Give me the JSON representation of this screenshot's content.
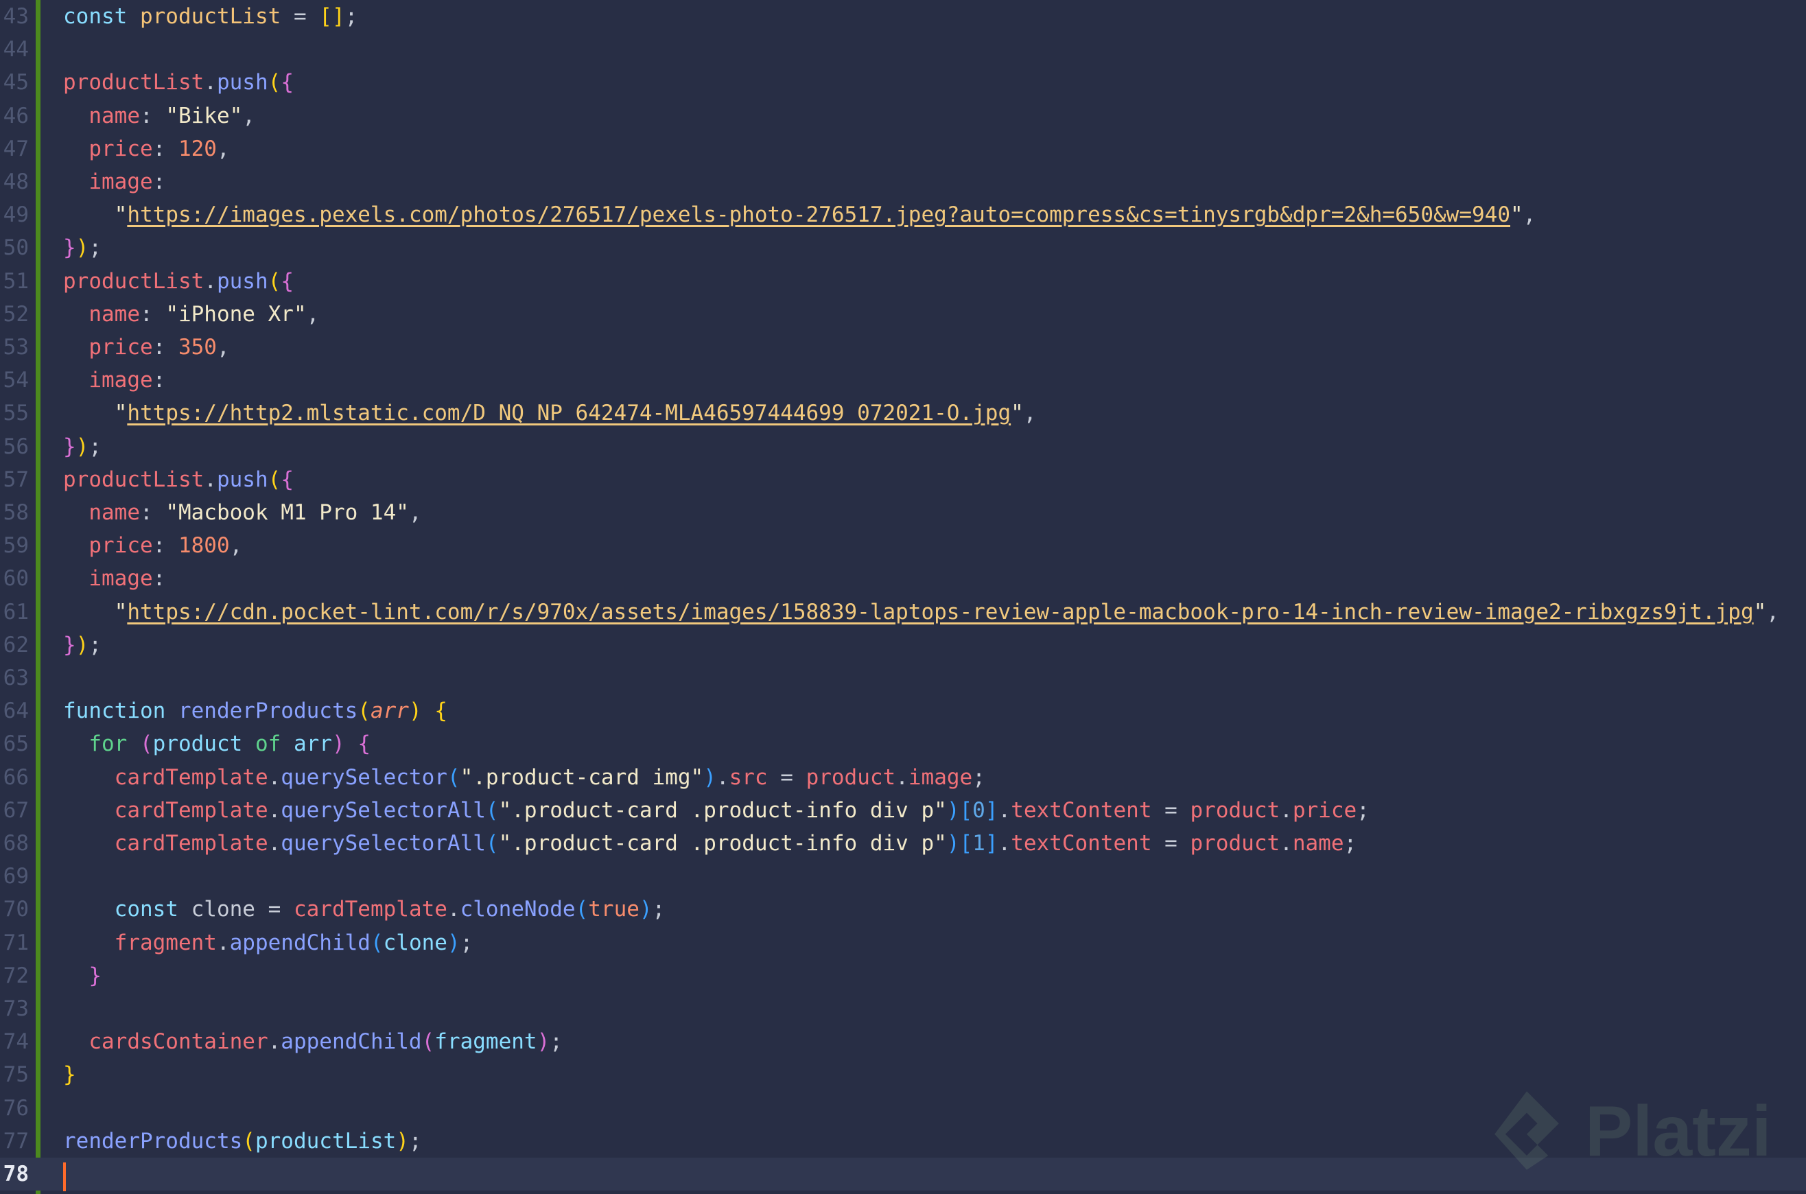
{
  "editor": {
    "active_line": 78,
    "watermark": "Platzi",
    "lines": [
      {
        "n": 43,
        "tokens": [
          [
            "kw",
            "const "
          ],
          [
            "var",
            "productList"
          ],
          [
            "punc",
            " = "
          ],
          [
            "b1",
            "[]"
          ],
          [
            "punc",
            ";"
          ]
        ]
      },
      {
        "n": 44,
        "tokens": []
      },
      {
        "n": 45,
        "tokens": [
          [
            "obj",
            "productList"
          ],
          [
            "punc",
            "."
          ],
          [
            "fn",
            "push"
          ],
          [
            "b1",
            "("
          ],
          [
            "b2",
            "{"
          ]
        ]
      },
      {
        "n": 46,
        "tokens": [
          [
            "punc",
            "  "
          ],
          [
            "prop",
            "name"
          ],
          [
            "punc",
            ": "
          ],
          [
            "str",
            "\"Bike\""
          ],
          [
            "punc",
            ","
          ]
        ]
      },
      {
        "n": 47,
        "tokens": [
          [
            "punc",
            "  "
          ],
          [
            "prop",
            "price"
          ],
          [
            "punc",
            ": "
          ],
          [
            "num",
            "120"
          ],
          [
            "punc",
            ","
          ]
        ]
      },
      {
        "n": 48,
        "tokens": [
          [
            "punc",
            "  "
          ],
          [
            "prop",
            "image"
          ],
          [
            "punc",
            ":"
          ]
        ]
      },
      {
        "n": 49,
        "tokens": [
          [
            "punc",
            "    "
          ],
          [
            "str",
            "\""
          ],
          [
            "url",
            "https://images.pexels.com/photos/276517/pexels-photo-276517.jpeg?auto=compress&cs=tinysrgb&dpr=2&h=650&w=940"
          ],
          [
            "str",
            "\""
          ],
          [
            "punc",
            ","
          ]
        ]
      },
      {
        "n": 50,
        "tokens": [
          [
            "b2",
            "}"
          ],
          [
            "b1",
            ")"
          ],
          [
            "punc",
            ";"
          ]
        ]
      },
      {
        "n": 51,
        "tokens": [
          [
            "obj",
            "productList"
          ],
          [
            "punc",
            "."
          ],
          [
            "fn",
            "push"
          ],
          [
            "b1",
            "("
          ],
          [
            "b2",
            "{"
          ]
        ]
      },
      {
        "n": 52,
        "tokens": [
          [
            "punc",
            "  "
          ],
          [
            "prop",
            "name"
          ],
          [
            "punc",
            ": "
          ],
          [
            "str",
            "\"iPhone Xr\""
          ],
          [
            "punc",
            ","
          ]
        ]
      },
      {
        "n": 53,
        "tokens": [
          [
            "punc",
            "  "
          ],
          [
            "prop",
            "price"
          ],
          [
            "punc",
            ": "
          ],
          [
            "num",
            "350"
          ],
          [
            "punc",
            ","
          ]
        ]
      },
      {
        "n": 54,
        "tokens": [
          [
            "punc",
            "  "
          ],
          [
            "prop",
            "image"
          ],
          [
            "punc",
            ":"
          ]
        ]
      },
      {
        "n": 55,
        "tokens": [
          [
            "punc",
            "    "
          ],
          [
            "str",
            "\""
          ],
          [
            "url",
            "https://http2.mlstatic.com/D_NQ_NP_642474-MLA46597444699_072021-O.jpg"
          ],
          [
            "str",
            "\""
          ],
          [
            "punc",
            ","
          ]
        ]
      },
      {
        "n": 56,
        "tokens": [
          [
            "b2",
            "}"
          ],
          [
            "b1",
            ")"
          ],
          [
            "punc",
            ";"
          ]
        ]
      },
      {
        "n": 57,
        "tokens": [
          [
            "obj",
            "productList"
          ],
          [
            "punc",
            "."
          ],
          [
            "fn",
            "push"
          ],
          [
            "b1",
            "("
          ],
          [
            "b2",
            "{"
          ]
        ]
      },
      {
        "n": 58,
        "tokens": [
          [
            "punc",
            "  "
          ],
          [
            "prop",
            "name"
          ],
          [
            "punc",
            ": "
          ],
          [
            "str",
            "\"Macbook M1 Pro 14\""
          ],
          [
            "punc",
            ","
          ]
        ]
      },
      {
        "n": 59,
        "tokens": [
          [
            "punc",
            "  "
          ],
          [
            "prop",
            "price"
          ],
          [
            "punc",
            ": "
          ],
          [
            "num",
            "1800"
          ],
          [
            "punc",
            ","
          ]
        ]
      },
      {
        "n": 60,
        "tokens": [
          [
            "punc",
            "  "
          ],
          [
            "prop",
            "image"
          ],
          [
            "punc",
            ":"
          ]
        ]
      },
      {
        "n": 61,
        "tokens": [
          [
            "punc",
            "    "
          ],
          [
            "str",
            "\""
          ],
          [
            "url",
            "https://cdn.pocket-lint.com/r/s/970x/assets/images/158839-laptops-review-apple-macbook-pro-14-inch-review-image2-ribxgzs9jt.jpg"
          ],
          [
            "str",
            "\""
          ],
          [
            "punc",
            ","
          ]
        ]
      },
      {
        "n": 62,
        "tokens": [
          [
            "b2",
            "}"
          ],
          [
            "b1",
            ")"
          ],
          [
            "punc",
            ";"
          ]
        ]
      },
      {
        "n": 63,
        "tokens": []
      },
      {
        "n": 64,
        "tokens": [
          [
            "kw",
            "function "
          ],
          [
            "fn",
            "renderProducts"
          ],
          [
            "b1",
            "("
          ],
          [
            "param",
            "arr"
          ],
          [
            "b1",
            ")"
          ],
          [
            "punc",
            " "
          ],
          [
            "b1",
            "{"
          ]
        ]
      },
      {
        "n": 65,
        "tokens": [
          [
            "punc",
            "  "
          ],
          [
            "for",
            "for "
          ],
          [
            "b2",
            "("
          ],
          [
            "kw",
            "product "
          ],
          [
            "for",
            "of "
          ],
          [
            "kw",
            "arr"
          ],
          [
            "b2",
            ")"
          ],
          [
            "punc",
            " "
          ],
          [
            "b2",
            "{"
          ]
        ]
      },
      {
        "n": 66,
        "tokens": [
          [
            "punc",
            "    "
          ],
          [
            "obj",
            "cardTemplate"
          ],
          [
            "punc",
            "."
          ],
          [
            "fn",
            "querySelector"
          ],
          [
            "b3",
            "("
          ],
          [
            "str",
            "\".product-card img\""
          ],
          [
            "b3",
            ")"
          ],
          [
            "punc",
            "."
          ],
          [
            "prop",
            "src"
          ],
          [
            "punc",
            " = "
          ],
          [
            "obj",
            "product"
          ],
          [
            "punc",
            "."
          ],
          [
            "prop",
            "image"
          ],
          [
            "punc",
            ";"
          ]
        ]
      },
      {
        "n": 67,
        "tokens": [
          [
            "punc",
            "    "
          ],
          [
            "obj",
            "cardTemplate"
          ],
          [
            "punc",
            "."
          ],
          [
            "fn",
            "querySelectorAll"
          ],
          [
            "b3",
            "("
          ],
          [
            "str",
            "\".product-card .product-info div p\""
          ],
          [
            "b3",
            ")"
          ],
          [
            "b3",
            "["
          ],
          [
            "idx",
            "0"
          ],
          [
            "b3",
            "]"
          ],
          [
            "punc",
            "."
          ],
          [
            "prop",
            "textContent"
          ],
          [
            "punc",
            " = "
          ],
          [
            "obj",
            "product"
          ],
          [
            "punc",
            "."
          ],
          [
            "prop",
            "price"
          ],
          [
            "punc",
            ";"
          ]
        ]
      },
      {
        "n": 68,
        "tokens": [
          [
            "punc",
            "    "
          ],
          [
            "obj",
            "cardTemplate"
          ],
          [
            "punc",
            "."
          ],
          [
            "fn",
            "querySelectorAll"
          ],
          [
            "b3",
            "("
          ],
          [
            "str",
            "\".product-card .product-info div p\""
          ],
          [
            "b3",
            ")"
          ],
          [
            "b3",
            "["
          ],
          [
            "idx",
            "1"
          ],
          [
            "b3",
            "]"
          ],
          [
            "punc",
            "."
          ],
          [
            "prop",
            "textContent"
          ],
          [
            "punc",
            " = "
          ],
          [
            "obj",
            "product"
          ],
          [
            "punc",
            "."
          ],
          [
            "prop",
            "name"
          ],
          [
            "punc",
            ";"
          ]
        ]
      },
      {
        "n": 69,
        "tokens": []
      },
      {
        "n": 70,
        "tokens": [
          [
            "punc",
            "    "
          ],
          [
            "kw",
            "const "
          ],
          [
            "plain",
            "clone"
          ],
          [
            "punc",
            " = "
          ],
          [
            "obj",
            "cardTemplate"
          ],
          [
            "punc",
            "."
          ],
          [
            "fn",
            "cloneNode"
          ],
          [
            "b3",
            "("
          ],
          [
            "bool",
            "true"
          ],
          [
            "b3",
            ")"
          ],
          [
            "punc",
            ";"
          ]
        ]
      },
      {
        "n": 71,
        "tokens": [
          [
            "punc",
            "    "
          ],
          [
            "obj",
            "fragment"
          ],
          [
            "punc",
            "."
          ],
          [
            "fn",
            "appendChild"
          ],
          [
            "b3",
            "("
          ],
          [
            "kw",
            "clone"
          ],
          [
            "b3",
            ")"
          ],
          [
            "punc",
            ";"
          ]
        ]
      },
      {
        "n": 72,
        "tokens": [
          [
            "punc",
            "  "
          ],
          [
            "b2",
            "}"
          ]
        ]
      },
      {
        "n": 73,
        "tokens": []
      },
      {
        "n": 74,
        "tokens": [
          [
            "punc",
            "  "
          ],
          [
            "obj",
            "cardsContainer"
          ],
          [
            "punc",
            "."
          ],
          [
            "fn",
            "appendChild"
          ],
          [
            "b2",
            "("
          ],
          [
            "kw",
            "fragment"
          ],
          [
            "b2",
            ")"
          ],
          [
            "punc",
            ";"
          ]
        ]
      },
      {
        "n": 75,
        "tokens": [
          [
            "b1",
            "}"
          ]
        ]
      },
      {
        "n": 76,
        "tokens": []
      },
      {
        "n": 77,
        "tokens": [
          [
            "fn",
            "renderProducts"
          ],
          [
            "b1",
            "("
          ],
          [
            "kw",
            "productList"
          ],
          [
            "b1",
            ")"
          ],
          [
            "punc",
            ";"
          ]
        ]
      },
      {
        "n": 78,
        "tokens": []
      }
    ]
  }
}
